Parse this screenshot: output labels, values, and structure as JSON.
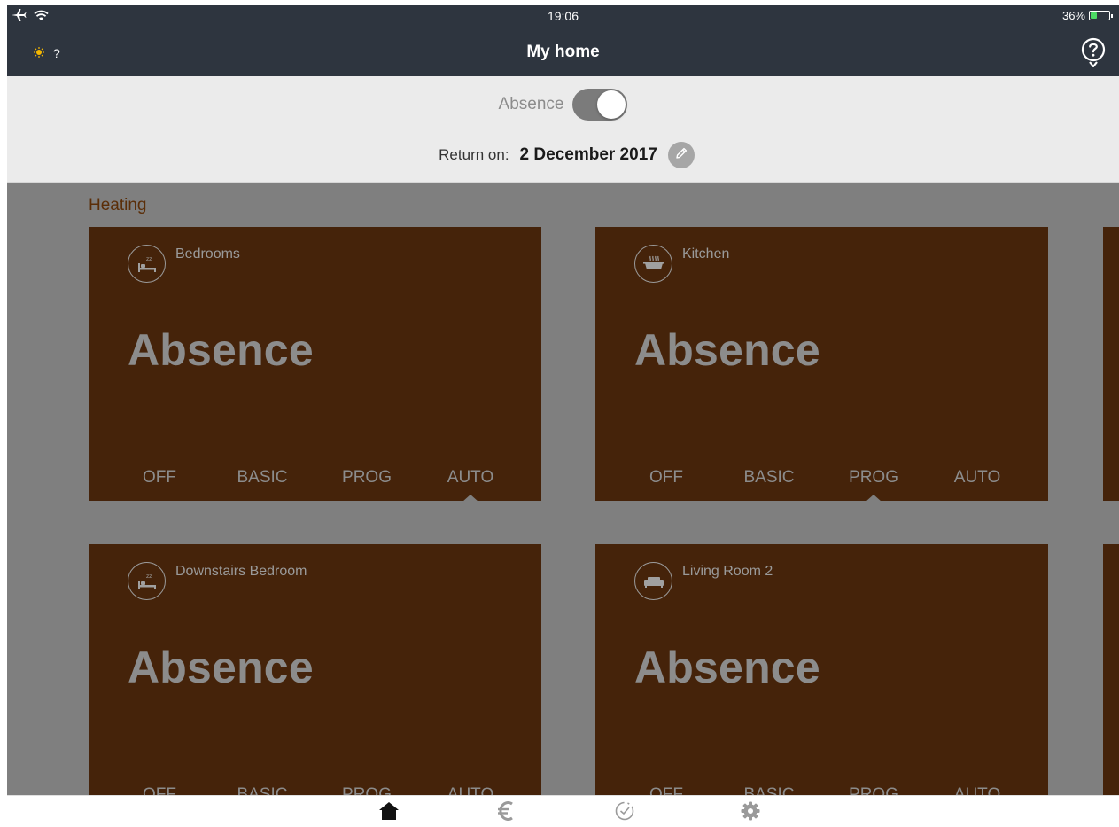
{
  "status_bar": {
    "time": "19:06",
    "battery_percent": "36%",
    "battery_level": 0.36,
    "icons": [
      "airplane-icon",
      "wifi-icon",
      "battery-icon"
    ]
  },
  "header": {
    "weather_icon": "sun-icon",
    "weather_text": "?",
    "title": "My home",
    "help_icon": "question-icon"
  },
  "absence": {
    "label": "Absence",
    "toggle_on": true,
    "return_label": "Return on:",
    "return_date": "2 December 2017",
    "edit_icon": "pencil-icon"
  },
  "section": {
    "title": "Heating"
  },
  "zones": [
    {
      "name": "Bedrooms",
      "icon": "bed-icon",
      "state": "Absence",
      "modes": [
        "OFF",
        "BASIC",
        "PROG",
        "AUTO"
      ],
      "selected_mode": "AUTO"
    },
    {
      "name": "Kitchen",
      "icon": "cooking-pot-icon",
      "state": "Absence",
      "modes": [
        "OFF",
        "BASIC",
        "PROG",
        "AUTO"
      ],
      "selected_mode": "PROG"
    },
    {
      "name": "Downstairs Bedroom",
      "icon": "bed-icon",
      "state": "Absence",
      "modes": [
        "OFF",
        "BASIC",
        "PROG",
        "AUTO"
      ],
      "selected_mode": ""
    },
    {
      "name": "Living Room 2",
      "icon": "sofa-icon",
      "state": "Absence",
      "modes": [
        "OFF",
        "BASIC",
        "PROG",
        "AUTO"
      ],
      "selected_mode": ""
    }
  ],
  "tab_bar": {
    "tabs": [
      {
        "id": "home",
        "icon": "home-icon",
        "active": true
      },
      {
        "id": "cost",
        "icon": "euro-icon",
        "active": false
      },
      {
        "id": "schedule",
        "icon": "clock-icon",
        "active": false
      },
      {
        "id": "settings",
        "icon": "gear-icon",
        "active": false
      }
    ]
  },
  "colors": {
    "header_bg": "#2e353f",
    "panel_bg": "#ebebeb",
    "content_bg": "#7f7f7f",
    "card_bg": "#45230a",
    "section_title": "#5b2e08",
    "battery_fill": "#4cd964"
  }
}
